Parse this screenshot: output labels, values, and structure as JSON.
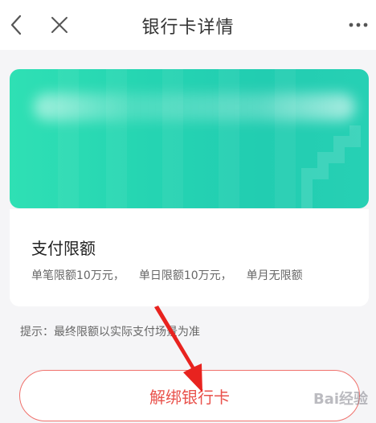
{
  "header": {
    "title": "银行卡详情",
    "back_icon": "chevron-left-icon",
    "close_icon": "close-icon",
    "more_icon": "more-icon"
  },
  "card": {
    "colors": [
      "#2fe0b4",
      "#22cdb1"
    ]
  },
  "pay_limit": {
    "title": "支付限额",
    "single": "单笔限额10万元，",
    "daily": "单日限额10万元，",
    "monthly": "单月无限额"
  },
  "tip": "提示：最终限额以实际支付场景为准",
  "unbind_button": {
    "label": "解绑银行卡",
    "color": "#e9524c"
  },
  "watermark": "Bai经验"
}
